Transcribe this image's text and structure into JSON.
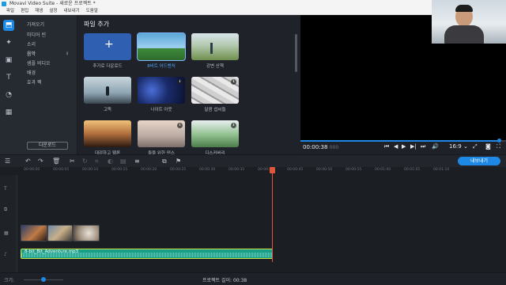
{
  "window": {
    "title": "Movavi Video Suite - 새로운 프로젝트 *",
    "controls": [
      "—",
      "□",
      "✕"
    ]
  },
  "menu": [
    "파일",
    "편집",
    "재생",
    "설정",
    "내보내기",
    "도움말"
  ],
  "rail": [
    {
      "icon": "import-icon",
      "active": true
    },
    {
      "icon": "magic-wand-icon"
    },
    {
      "icon": "transitions-icon"
    },
    {
      "icon": "titles-icon"
    },
    {
      "icon": "stickers-icon"
    },
    {
      "icon": "more-icon"
    }
  ],
  "categories": [
    "가져오기",
    "미디어 빈",
    "소리",
    "음악",
    "샘플 비디오",
    "배경",
    "효과 팩"
  ],
  "active_category": "음악",
  "download_button": "다운로드",
  "media": {
    "title": "파일 추가",
    "items": [
      {
        "label": "추가로 다운로드",
        "kind": "add"
      },
      {
        "label": "8비트 어드벤처",
        "kind": "8bit",
        "selected": true
      },
      {
        "label": "강변 산책",
        "kind": "walk"
      },
      {
        "label": "고독",
        "kind": "solitude"
      },
      {
        "label": "나이트 아웃",
        "kind": "night",
        "download": true
      },
      {
        "label": "달콤 섭씨들",
        "kind": "photos",
        "download": true
      },
      {
        "label": "대감하고 웹론",
        "kind": "party"
      },
      {
        "label": "둘을 위한 댄스",
        "kind": "dance",
        "download": true
      },
      {
        "label": "디스커버리",
        "kind": "discovery",
        "download": true
      }
    ]
  },
  "player": {
    "time": "00:00:38",
    "time_ms": "000",
    "progress": 0.97,
    "aspect": "16:9"
  },
  "timeline": {
    "export_label": "내보내기",
    "ticks": [
      "00:00:00",
      "00:00:05",
      "00:00:10",
      "00:00:15",
      "00:00:20",
      "00:00:25",
      "00:00:30",
      "00:00:35",
      "00:00:40",
      "00:00:45",
      "00:00:50",
      "00:00:55",
      "00:01:00",
      "00:01:05",
      "00:01:10"
    ],
    "audio_clip": "8-bit_Bit_Adventure.mp3"
  },
  "status": {
    "zoom_label": "크기:",
    "duration_label": "프로젝트 길이: 00:38"
  }
}
